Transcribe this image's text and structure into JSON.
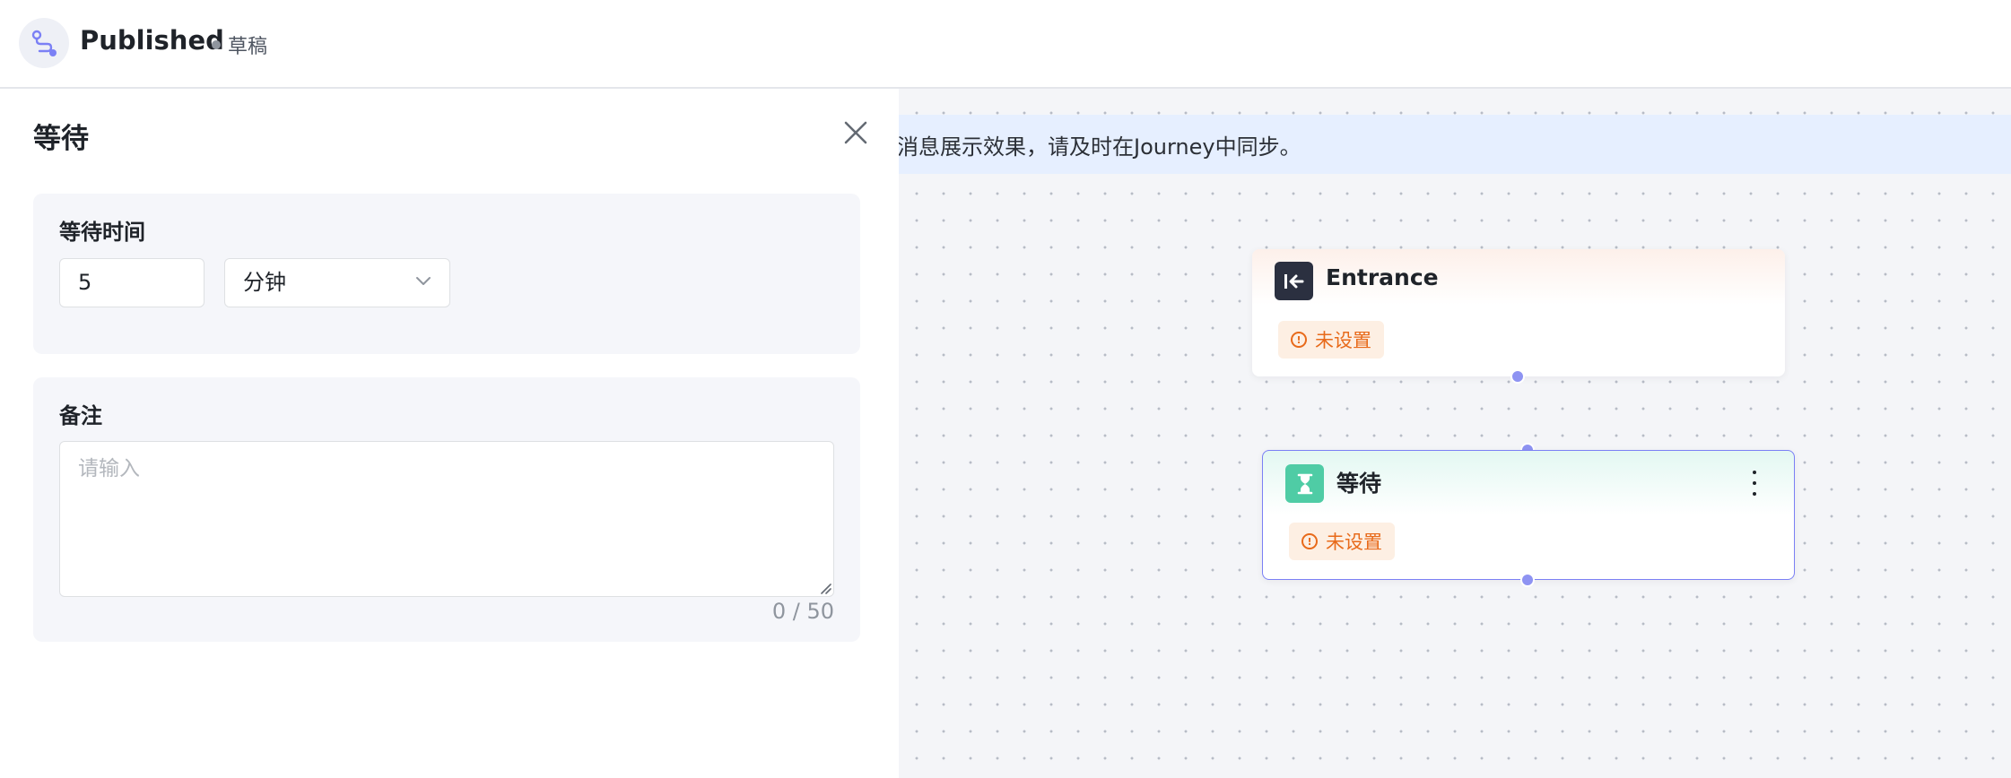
{
  "header": {
    "title": "Published",
    "status": "草稿",
    "logo_icon": "journey-flow-icon"
  },
  "canvas": {
    "notice": "消息展示效果，请及时在Journey中同步。",
    "nodes": [
      {
        "title": "Entrance",
        "icon": "entrance-arrow-icon",
        "icon_color": "#2b3040",
        "tag": "未设置"
      },
      {
        "title": "等待",
        "icon": "hourglass-icon",
        "icon_color": "#4fcca5",
        "tag": "未设置",
        "selected": true
      }
    ]
  },
  "panel": {
    "title": "等待",
    "wait_section": {
      "label": "等待时间",
      "value": "5",
      "unit": "分钟"
    },
    "note_section": {
      "label": "备注",
      "placeholder": "请输入",
      "counter": "0 / 50"
    }
  },
  "colors": {
    "accent": "#7b80f5",
    "warning": "#e86a1a",
    "notice_bg": "#e6efff"
  }
}
